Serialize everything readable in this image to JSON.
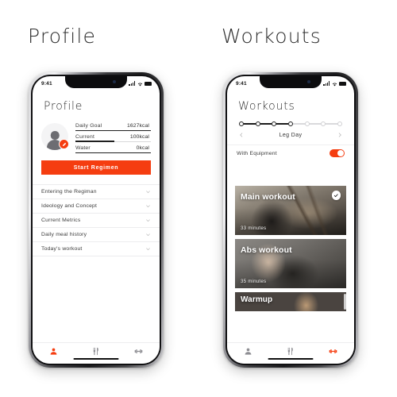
{
  "sections": {
    "profile_title": "Profile",
    "workouts_title": "Workouts"
  },
  "colors": {
    "accent": "#F53D10",
    "text": "#2e2e2e",
    "muted": "#8e8e93"
  },
  "status_bar": {
    "time": "9:41",
    "signal_icon": "cellular-signal-icon",
    "wifi_icon": "wifi-icon",
    "battery_icon": "battery-icon"
  },
  "profile_screen": {
    "title": "Profile",
    "avatar": {
      "icon": "user-avatar-icon",
      "badge_icon": "edit-badge-icon"
    },
    "metrics": [
      {
        "label": "Daily Goal",
        "value": "1627kcal"
      },
      {
        "label": "Current",
        "value": "100kcal"
      },
      {
        "label": "Water",
        "value": "0kcal"
      }
    ],
    "cta": "Start Regimen",
    "accordion": [
      {
        "label": "Entering the Regiman"
      },
      {
        "label": "Ideology and Concept"
      },
      {
        "label": "Current Metrics"
      },
      {
        "label": "Daily meal history"
      },
      {
        "label": "Today's workout"
      }
    ],
    "tabs": [
      {
        "name": "profile",
        "icon": "person-icon",
        "active": true
      },
      {
        "name": "nutrition",
        "icon": "fork-knife-icon",
        "active": false
      },
      {
        "name": "workouts",
        "icon": "dumbbell-icon",
        "active": false
      }
    ]
  },
  "workouts_screen": {
    "title": "Workouts",
    "stepper": {
      "total": 7,
      "completed": 4
    },
    "day_nav": {
      "prev_icon": "chevron-left-icon",
      "next_icon": "chevron-right-icon",
      "day": "Leg Day"
    },
    "equipment": {
      "label": "With Equipment",
      "toggle_on": true
    },
    "cards": [
      {
        "title": "Main workout",
        "duration": "33 minutes",
        "checked": true,
        "photo": "ph-ropes"
      },
      {
        "title": "Abs workout",
        "duration": "35 minutes",
        "checked": false,
        "photo": "ph-abs"
      },
      {
        "title": "Warmup",
        "duration": "",
        "checked": false,
        "photo": "ph-warm"
      }
    ],
    "tabs": [
      {
        "name": "profile",
        "icon": "person-icon",
        "active": false
      },
      {
        "name": "nutrition",
        "icon": "fork-knife-icon",
        "active": false
      },
      {
        "name": "workouts",
        "icon": "dumbbell-icon",
        "active": true
      }
    ]
  }
}
